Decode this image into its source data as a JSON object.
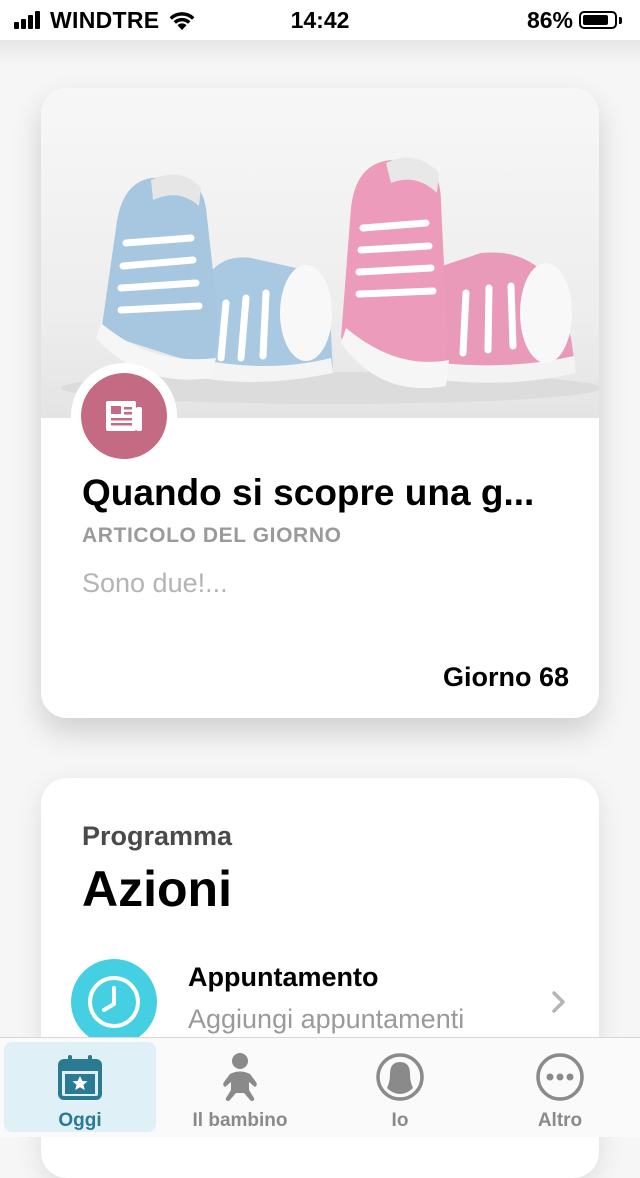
{
  "status_bar": {
    "carrier": "WINDTRE",
    "time": "14:42",
    "battery_percent": "86%",
    "battery_level": 0.86
  },
  "article": {
    "title": "Quando si scopre una g...",
    "type_label": "ARTICOLO DEL GIORNO",
    "excerpt": "Sono due!...",
    "day_label": "Giorno 68",
    "badge_icon": "newspaper-icon",
    "badge_color": "#c46a82"
  },
  "program": {
    "kicker": "Programma",
    "title": "Azioni",
    "action": {
      "title": "Appuntamento",
      "subtitle": "Aggiungi appuntamenti",
      "icon": "clock-icon",
      "icon_color": "#45cfe2"
    }
  },
  "tab_bar": {
    "tabs": [
      {
        "label": "Oggi",
        "icon": "calendar-star-icon",
        "active": true
      },
      {
        "label": "Il bambino",
        "icon": "baby-icon",
        "active": false
      },
      {
        "label": "Io",
        "icon": "mother-profile-icon",
        "active": false
      },
      {
        "label": "Altro",
        "icon": "more-icon",
        "active": false
      }
    ],
    "active_color": "#2b7a94"
  }
}
